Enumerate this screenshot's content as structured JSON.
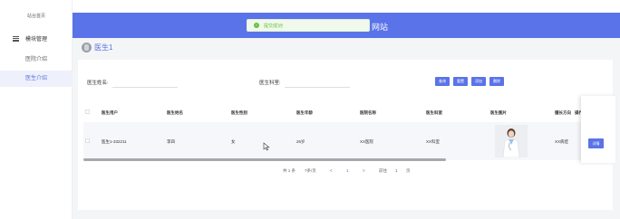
{
  "sidebar": {
    "home": "站台首页",
    "module": "模块管理",
    "items": [
      {
        "label": "医院介绍"
      },
      {
        "label": "医生介绍"
      }
    ]
  },
  "header": {
    "title": "网站"
  },
  "toast": {
    "message": "提交成功!"
  },
  "breadcrumb": {
    "label": "医生1"
  },
  "search": {
    "name_label": "医生姓名:",
    "name_value": "",
    "dept_label": "医生科室:",
    "dept_value": "",
    "buttons": {
      "query": "查询",
      "reset": "重置",
      "add": "添加",
      "delete": "删除"
    }
  },
  "table": {
    "headers": [
      "医生用户",
      "医生姓名",
      "医生性别",
      "医生年龄",
      "医院名称",
      "医生科室",
      "医生图片",
      "擅长方向",
      "操作"
    ],
    "rows": [
      {
        "user": "医生1-332211",
        "name": "李四",
        "gender": "女",
        "age": "26岁",
        "hospital": "XX医院",
        "dept": "XX科室",
        "specialty": "XX病症",
        "action": "详情"
      }
    ]
  },
  "pagination": {
    "total": "共 1 条",
    "page_size": "7条/页",
    "prev": "<",
    "current": "1",
    "next": ">",
    "goto_prefix": "前往",
    "goto_value": "1",
    "goto_suffix": "页"
  },
  "colors": {
    "primary": "#5b73e8",
    "success": "#67c23a",
    "sidebar_active_bg": "#eef1fb"
  }
}
